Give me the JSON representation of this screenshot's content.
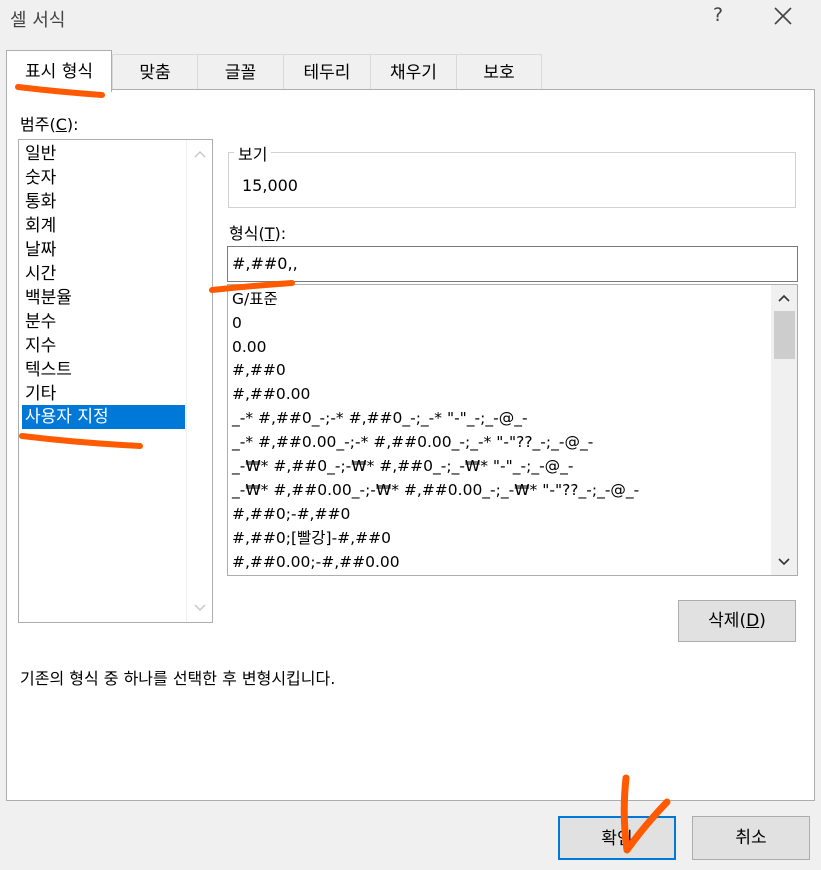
{
  "window": {
    "title": "셀 서식",
    "help_label": "?",
    "close_icon": "close-icon"
  },
  "tabs": [
    {
      "label": "표시 형식",
      "active": true
    },
    {
      "label": "맞춤",
      "active": false
    },
    {
      "label": "글꼴",
      "active": false
    },
    {
      "label": "테두리",
      "active": false
    },
    {
      "label": "채우기",
      "active": false
    },
    {
      "label": "보호",
      "active": false
    }
  ],
  "category": {
    "label_text": "범주(",
    "label_key": "C",
    "label_end": "):",
    "items": [
      "일반",
      "숫자",
      "통화",
      "회계",
      "날짜",
      "시간",
      "백분율",
      "분수",
      "지수",
      "텍스트",
      "기타",
      "사용자 지정"
    ],
    "selected": "사용자 지정"
  },
  "preview": {
    "title": "보기",
    "sample": "15,000"
  },
  "format": {
    "label_text": "형식(",
    "label_key": "T",
    "label_end": "):",
    "value": "#,##0,,",
    "list": [
      "G/표준",
      "0",
      "0.00",
      "#,##0",
      "#,##0.00",
      "_-* #,##0_-;-* #,##0_-;_-* \"-\"_-;_-@_-",
      "_-* #,##0.00_-;-* #,##0.00_-;_-* \"-\"??_-;_-@_-",
      "_-₩* #,##0_-;-₩* #,##0_-;_-₩* \"-\"_-;_-@_-",
      "_-₩* #,##0.00_-;-₩* #,##0.00_-;_-₩* \"-\"??_-;_-@_-",
      "#,##0;-#,##0",
      "#,##0;[빨강]-#,##0",
      "#,##0.00;-#,##0.00"
    ]
  },
  "buttons": {
    "delete_text": "삭제(",
    "delete_key": "D",
    "delete_end": ")",
    "ok": "확인",
    "cancel": "취소"
  },
  "description": "기존의 형식 중 하나를 선택한 후 변형시킵니다.",
  "colors": {
    "selection": "#0078d7",
    "annotation": "#ff5a00"
  }
}
